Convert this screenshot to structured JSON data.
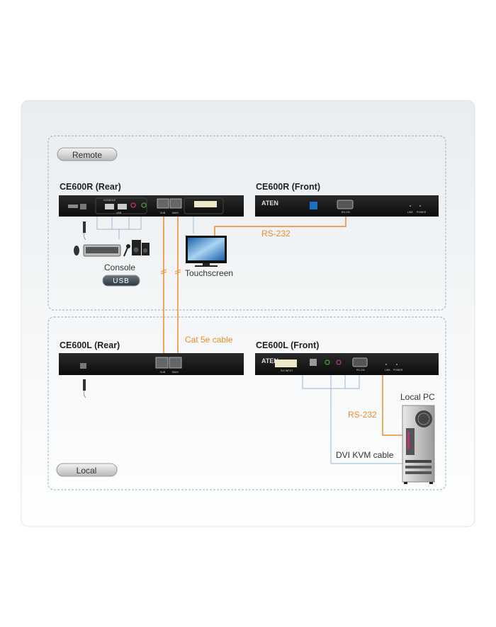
{
  "zones": {
    "remote": "Remote",
    "local": "Local"
  },
  "devices": {
    "remote_rear": {
      "title": "CE600R (Rear)",
      "ports": [
        "CONSOLE",
        "USB",
        "SUB",
        "MAIN"
      ]
    },
    "remote_front": {
      "title": "CE600R (Front)",
      "brand": "ATEN",
      "ports": [
        "RS-232",
        "LINK",
        "POWER"
      ]
    },
    "local_rear": {
      "title": "CE600L (Rear)",
      "ports": [
        "SUB",
        "MAIN"
      ]
    },
    "local_front": {
      "title": "CE600L (Front)",
      "brand": "ATEN",
      "ports": [
        "DVI INPUT",
        "RS-232",
        "LINK",
        "POWER"
      ]
    }
  },
  "labels": {
    "console": "Console",
    "usb_badge": "USB",
    "touchscreen": "Touchscreen",
    "rs232_remote": "RS-232",
    "cat5e": "Cat 5e cable",
    "local_pc": "Local PC",
    "rs232_local": "RS-232",
    "dvi_kvm": "DVI KVM cable"
  },
  "colors": {
    "cable_cat5e": "#f08a2c",
    "cable_console": "#9ab8d4",
    "device_body": "#1a1a1a"
  }
}
